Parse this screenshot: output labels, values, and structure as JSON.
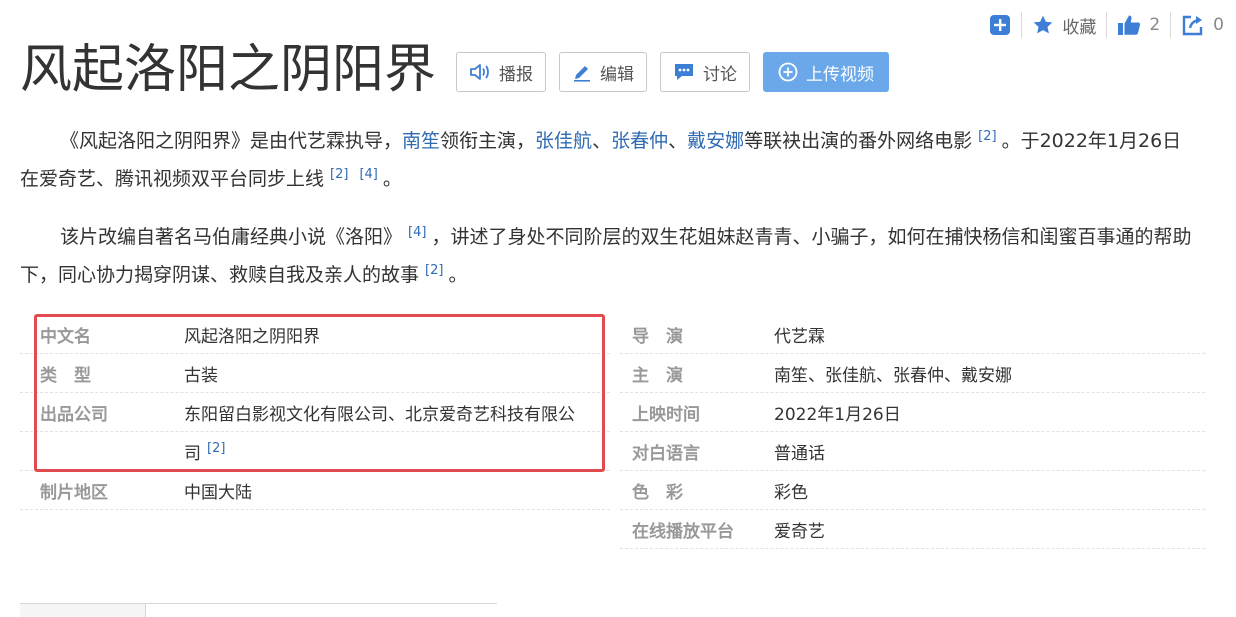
{
  "topbar": {
    "favorite_label": "收藏",
    "like_count": "2",
    "share_count": "0"
  },
  "title": "风起洛阳之阴阳界",
  "buttons": {
    "broadcast": "播报",
    "edit": "编辑",
    "discuss": "讨论",
    "upload_video": "上传视频"
  },
  "summary": {
    "p1_prefix": "《风起洛阳之阴阳界》是由代艺霖执导，",
    "link_nanxiao": "南笙",
    "p1_mid1": "领衔主演，",
    "link_zhangjiahang": "张佳航",
    "sep1": "、",
    "link_zhangchunzhong": "张春仲",
    "sep2": "、",
    "link_daianna": "戴安娜",
    "p1_mid2": "等联袂出演的番外网络电影",
    "ref_2a": "[2]",
    "p1_mid3": "。于2022年1月26日在爱奇艺、腾讯视频双平台同步上线",
    "ref_2b": "[2]",
    "ref_4a": "[4]",
    "p1_end": "。",
    "p2_prefix": "该片改编自著名马伯庸经典小说《洛阳》",
    "ref_4b": "[4]",
    "p2_mid": "，讲述了身处不同阶层的双生花姐妹赵青青、小骗子，如何在捕快杨信和闺蜜百事通的帮助下，同心协力揭穿阴谋、救赎自我及亲人的故事",
    "ref_2c": "[2]",
    "p2_end": "。"
  },
  "info_left": {
    "chinese_name_key": "中文名",
    "chinese_name_val": "风起洛阳之阴阳界",
    "type_key": "类　型",
    "type_val": "古装",
    "company_key": "出品公司",
    "company_val": "东阳留白影视文化有限公司、北京爱奇艺科技有限公",
    "company_val_cont": "司",
    "company_ref": "[2]",
    "region_key": "制片地区",
    "region_val": "中国大陆"
  },
  "info_right": {
    "director_key": "导　演",
    "director_val": "代艺霖",
    "cast_key": "主　演",
    "cast_val": "南笙、张佳航、张春仲、戴安娜",
    "release_key": "上映时间",
    "release_val": "2022年1月26日",
    "language_key": "对白语言",
    "language_val": "普通话",
    "color_key": "色　彩",
    "color_val": "彩色",
    "platform_key": "在线播放平台",
    "platform_val": "爱奇艺"
  },
  "colors": {
    "link": "#2f6bb3",
    "icon_blue": "#3d7fd6",
    "primary_button": "#6aa8ea",
    "highlight": "#e14a4f"
  },
  "icons": [
    "add-icon",
    "star-icon",
    "thumbs-up-icon",
    "share-icon",
    "speaker-icon",
    "pencil-icon",
    "chat-icon",
    "plus-circle-icon"
  ]
}
